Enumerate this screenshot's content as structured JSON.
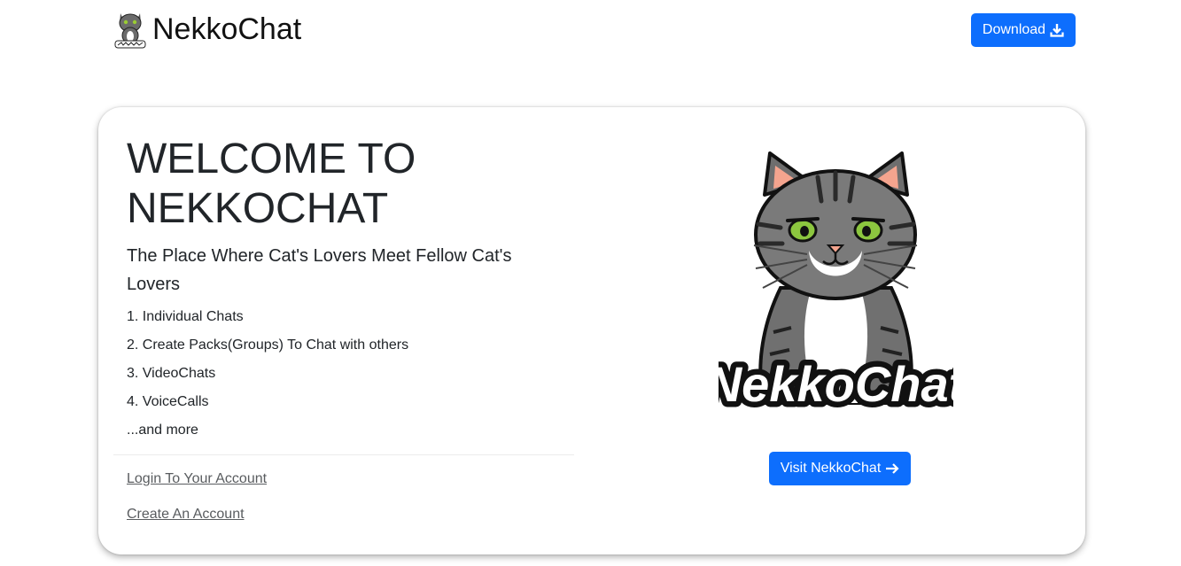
{
  "header": {
    "brand_name": "NekkoChat",
    "download_label": "Download"
  },
  "hero": {
    "title": "WELCOME TO NEKKOCHAT",
    "tagline": "The Place Where Cat's Lovers Meet Fellow Cat's Lovers",
    "features": [
      "1. Individual Chats",
      "2. Create Packs(Groups) To Chat with others",
      "3. VideoChats",
      "4. VoiceCalls",
      "...and more"
    ],
    "login_link": "Login To Your Account",
    "create_link": "Create An Account",
    "logo_text": "NekkoChat",
    "visit_label": "Visit NekkoChat"
  },
  "icons": {
    "brand": "cat-logo-icon",
    "download": "download-icon",
    "visit": "arrow-right-icon"
  },
  "colors": {
    "primary": "#0d6efd",
    "text": "#212529",
    "link": "#595c5f"
  }
}
